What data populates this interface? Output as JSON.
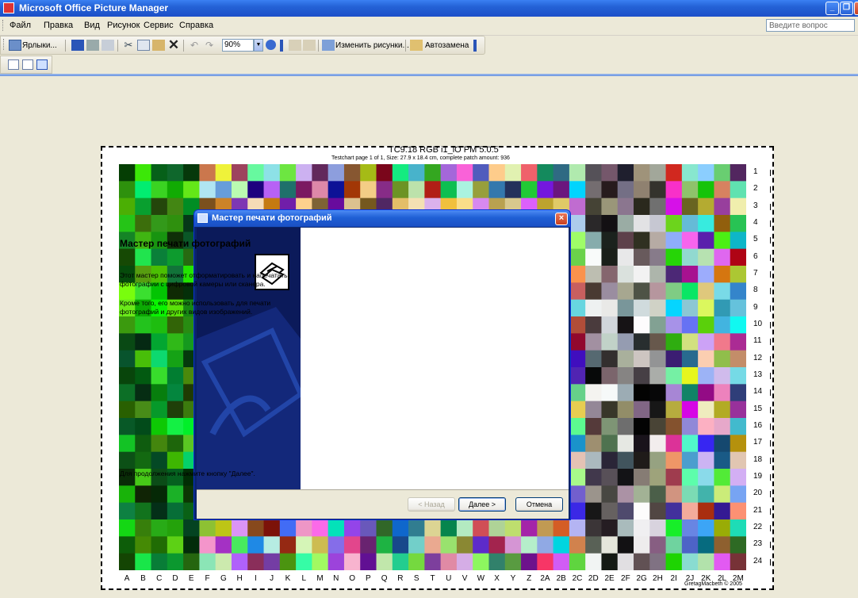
{
  "window": {
    "title": "Microsoft Office Picture Manager"
  },
  "menubar": {
    "items": [
      "Файл",
      "Правка",
      "Вид",
      "Рисунок",
      "Сервис",
      "Справка"
    ],
    "help_placeholder": "Введите вопрос"
  },
  "toolbar": {
    "shortcuts_label": "Ярлыки...",
    "zoom_value": "90%",
    "edit_pictures_label": "Изменить рисунки...",
    "autocorrect_label": "Автозамена"
  },
  "canvas": {
    "title": "TC9.18 RGB i1_iO PM 5.0.5",
    "subtitle": "Testchart page 1 of 1, Size: 27.9 x 18.4 cm, complete patch amount: 936",
    "column_labels": [
      "A",
      "B",
      "C",
      "D",
      "E",
      "F",
      "G",
      "H",
      "I",
      "J",
      "K",
      "L",
      "M",
      "N",
      "O",
      "P",
      "Q",
      "R",
      "S",
      "T",
      "U",
      "V",
      "W",
      "X",
      "Y",
      "Z",
      "2A",
      "2B",
      "2C",
      "2D",
      "2E",
      "2F",
      "2G",
      "2H",
      "2I",
      "2J",
      "2K",
      "2L",
      "2M"
    ],
    "row_labels": [
      "1",
      "2",
      "3",
      "4",
      "5",
      "6",
      "7",
      "8",
      "9",
      "10",
      "11",
      "12",
      "13",
      "14",
      "15",
      "16",
      "17",
      "18",
      "19",
      "20",
      "21",
      "22",
      "23",
      "24"
    ],
    "copyright": "GretagMacbeth © 2005"
  },
  "dialog": {
    "title": "Мастер печати фотографий",
    "heading": "Мастер печати фотографий",
    "text1_line1": "Этот мастер поможет отформатировать и напечатать",
    "text1_line2": "фотографии с цифровой камеры или сканера.",
    "text2_line1": "Кроме того, его можно использовать для печати",
    "text2_line2": "фотографий и других видов изображений.",
    "footer_text": "Для продолжения нажмите кнопку \"Далее\".",
    "back_label": "< Назад",
    "next_label": "Далее >",
    "cancel_label": "Отмена"
  },
  "colors": {
    "xp_blue": "#2462d6",
    "dialog_side": "#0b1a5a",
    "close_red": "#c8401f",
    "window_bg": "#ece9d8"
  }
}
